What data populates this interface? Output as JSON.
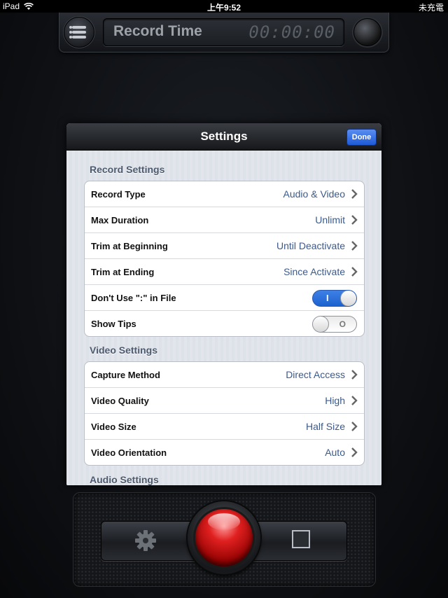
{
  "status_bar": {
    "device": "iPad",
    "time": "上午9:52",
    "battery": "未充電"
  },
  "top_bar": {
    "label": "Record Time",
    "timer": "00:00:00"
  },
  "modal": {
    "title": "Settings",
    "done_label": "Done",
    "sections": [
      {
        "title": "Record Settings",
        "rows": [
          {
            "label": "Record Type",
            "value": "Audio & Video"
          },
          {
            "label": "Max Duration",
            "value": "Unlimit"
          },
          {
            "label": "Trim at Beginning",
            "value": "Until Deactivate"
          },
          {
            "label": "Trim at Ending",
            "value": "Since Activate"
          },
          {
            "label": "Don't Use \":\" in File",
            "switch": "on",
            "switch_mark": "I"
          },
          {
            "label": "Show Tips",
            "switch": "off",
            "switch_mark": "O"
          }
        ]
      },
      {
        "title": "Video Settings",
        "rows": [
          {
            "label": "Capture Method",
            "value": "Direct Access"
          },
          {
            "label": "Video Quality",
            "value": "High"
          },
          {
            "label": "Video Size",
            "value": "Half Size"
          },
          {
            "label": "Video Orientation",
            "value": "Auto"
          }
        ]
      },
      {
        "title": "Audio Settings",
        "rows": []
      }
    ]
  },
  "colors": {
    "done_button": "#1e5ad6",
    "value_text": "#3b5a8c",
    "switch_on": "#2a6fdc",
    "record_button": "#c00000"
  },
  "icons": {
    "menu": "list-icon",
    "settings": "gear-icon",
    "stop": "stop-icon",
    "record": "record-icon",
    "chevron": "chevron-right-icon"
  }
}
